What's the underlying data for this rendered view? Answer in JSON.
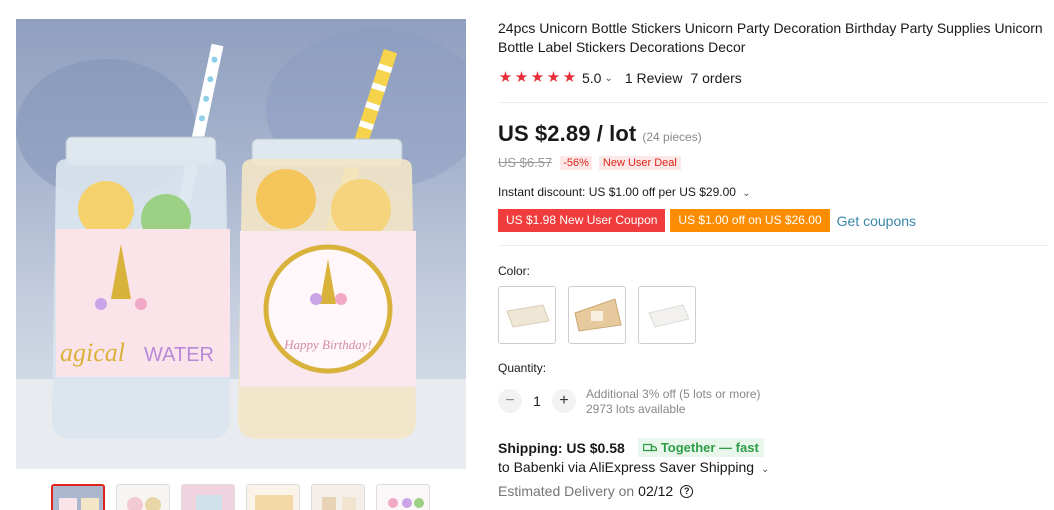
{
  "product": {
    "title": "24pcs Unicorn Bottle Stickers Unicorn Party Decoration Birthday Party Supplies Unicorn Bottle Label Stickers Decorations Decor",
    "rating": {
      "score": "5.0",
      "stars": 5,
      "reviews": "1 Review",
      "orders": "7 orders",
      "star_color": "#e62e3a"
    },
    "image": {
      "left_label_text": "agical",
      "left_label_text2": "WATER",
      "right_label_text": "Happy Birthday!"
    }
  },
  "price": {
    "current": "US $2.89 / lot",
    "pieces": "(24 pieces)",
    "original": "US $6.57",
    "discount": "-56%",
    "deal": "New User Deal"
  },
  "instant_discount": "Instant discount: US $1.00 off per US $29.00",
  "coupons": [
    {
      "label": "US $1.98 New User Coupon",
      "color": "#f03c3c"
    },
    {
      "label": "US $1.00 off on US $26.00",
      "color": "#fd8d00"
    }
  ],
  "get_coupons": "Get coupons",
  "color": {
    "label": "Color:"
  },
  "quantity": {
    "label": "Quantity:",
    "value": "1",
    "minus": "−",
    "plus": "+",
    "note_line1": "Additional 3% off (5 lots or more)",
    "note_line2": "2973 lots available"
  },
  "shipping": {
    "label": "Shipping: US $0.58",
    "badge": "Together — fast",
    "to": "to Babenki via AliExpress Saver Shipping",
    "delivery_prefix": "Estimated Delivery on",
    "delivery_date": "02/12",
    "help": "?"
  },
  "icons": {
    "chevron": "chevron-down-icon",
    "truck": "truck-icon",
    "help": "help-circle-icon",
    "star": "star-icon"
  }
}
